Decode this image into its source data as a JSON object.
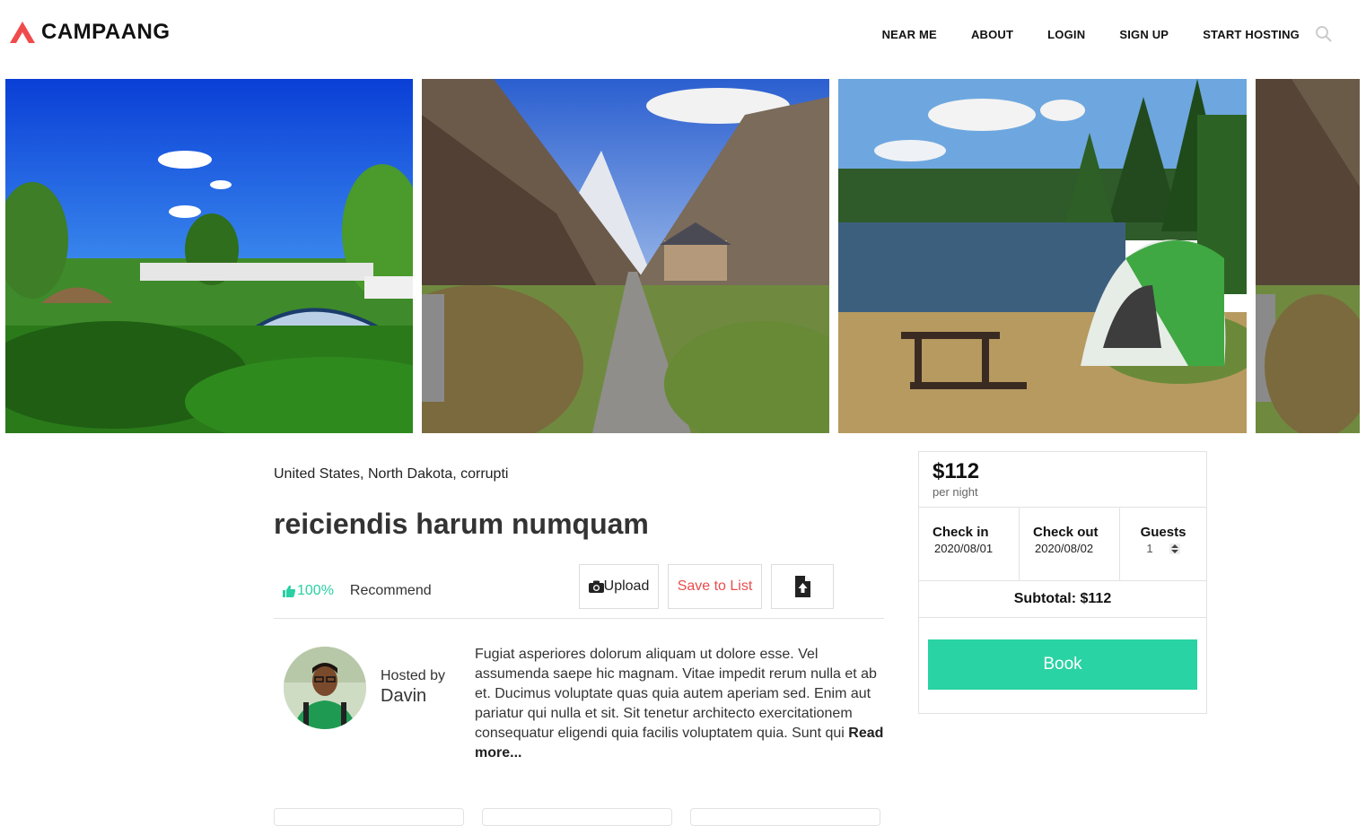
{
  "brand": {
    "name": "CAMPAANG",
    "accent": "#f04b4b"
  },
  "nav": {
    "items": [
      "NEAR ME",
      "ABOUT",
      "LOGIN",
      "SIGN UP",
      "START HOSTING"
    ],
    "search_icon": "search-icon"
  },
  "gallery": {
    "images": [
      "campground-tents",
      "mountain-valley-path",
      "lake-tent-picnic",
      "mountain-valley-partial"
    ]
  },
  "listing": {
    "location": "United States, North Dakota, corrupti",
    "title": "reiciendis harum numquam",
    "rating_percent": "100%",
    "recommend_label": "Recommend",
    "actions": {
      "upload": "Upload",
      "save": "Save to List"
    },
    "host": {
      "label": "Hosted by",
      "name": "Davin"
    },
    "description": "Fugiat asperiores dolorum aliquam ut dolore esse. Vel assumenda saepe hic magnam. Vitae impedit rerum nulla et ab et. Ducimus voluptate quas quia autem aperiam sed. Enim aut pariatur qui nulla et sit. Sit tenetur architecto exercitationem consequatur eligendi quia facilis voluptatem quia. Sunt qui",
    "read_more": "Read more..."
  },
  "booking": {
    "price": "$112",
    "per_night": "per night",
    "check_in_label": "Check in",
    "check_in_value": "2020/08/01",
    "check_out_label": "Check out",
    "check_out_value": "2020/08/02",
    "guests_label": "Guests",
    "guests_value": "1",
    "subtotal": "Subtotal: $112",
    "book_label": "Book",
    "book_color": "#29d3a3"
  }
}
